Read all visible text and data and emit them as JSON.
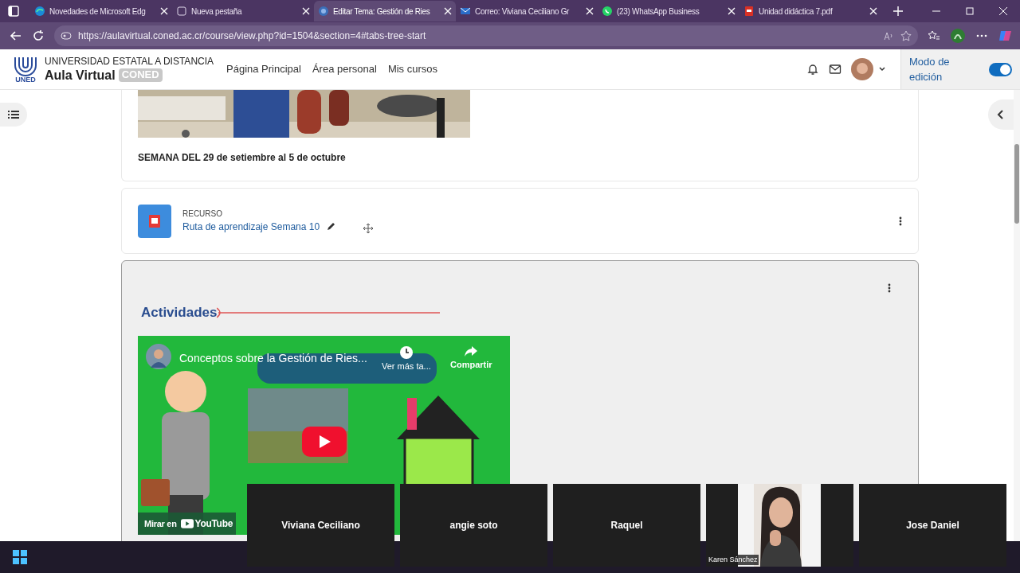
{
  "browser": {
    "tabs": [
      {
        "title": "Novedades de Microsoft Edg",
        "selected": false,
        "kind": "browser"
      },
      {
        "title": "Nueva pestaña",
        "selected": false,
        "kind": "blank"
      },
      {
        "title": "Editar Tema: Gestión de Ries",
        "selected": true,
        "kind": "site"
      },
      {
        "title": "Correo: Viviana Ceciliano Gr",
        "selected": false,
        "kind": "mail"
      },
      {
        "title": "(23) WhatsApp Business",
        "selected": false,
        "kind": "chat"
      },
      {
        "title": "Unidad didáctica 7.pdf",
        "selected": false,
        "kind": "pdf"
      }
    ],
    "url": "https://aulavirtual.coned.ac.cr/course/view.php?id=1504&section=4#tabs-tree-start"
  },
  "header": {
    "logo_mark": "UNED",
    "logo_title": "UNIVERSIDAD ESTATAL A DISTANCIA",
    "logo_subtitle": "Aula Virtual",
    "logo_badge": "CONED",
    "nav": [
      "Página Principal",
      "Área personal",
      "Mis cursos"
    ],
    "edit_mode": {
      "label": "Modo de edición",
      "on": true
    }
  },
  "section": {
    "dates": "SEMANA DEL 29 de setiembre al 5 de octubre"
  },
  "resource": {
    "type_label": "RECURSO",
    "title": "Ruta de aprendizaje Semana 10"
  },
  "activities": {
    "heading": "Actividades",
    "video": {
      "title": "Conceptos sobre la Gestión de Ries...",
      "watch_later": "Ver más ta...",
      "share": "Compartir",
      "watch_on": "Mirar en",
      "brand": "YouTube"
    }
  },
  "participants": [
    {
      "name": "Viviana Ceciliano",
      "video": false
    },
    {
      "name": "angie soto",
      "video": false
    },
    {
      "name": "Raquel",
      "video": false
    },
    {
      "name": "Karen Sánchez",
      "video": true
    },
    {
      "name": "Jose Daniel",
      "video": false
    }
  ]
}
